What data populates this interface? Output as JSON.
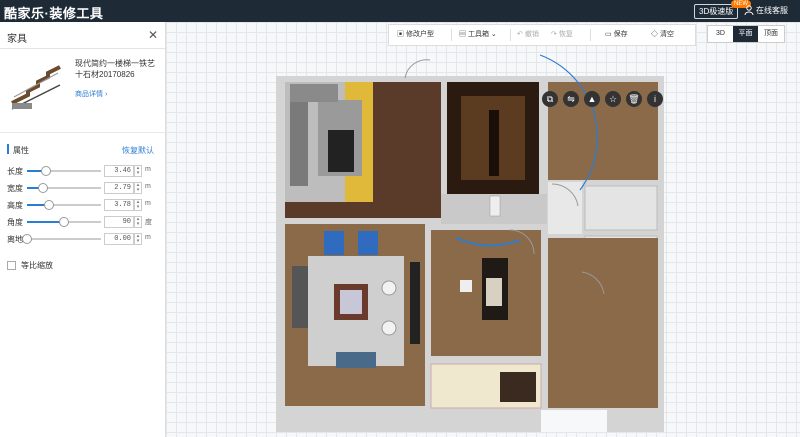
{
  "topbar": {
    "brand": "酷家乐·装修工具",
    "speed_button": "3D极速版",
    "speed_badge": "NEW",
    "service": "在线客服"
  },
  "panel": {
    "title": "家具",
    "product_name": "现代简约一楼梯一铁艺十石材20170826",
    "product_link": "商品详情 ›",
    "section_title": "属性",
    "reset_label": "恢复默认",
    "props": [
      {
        "label": "长度",
        "value": "3.46",
        "unit": "m",
        "level": 0.26
      },
      {
        "label": "宽度",
        "value": "2.79",
        "unit": "m",
        "level": 0.22
      },
      {
        "label": "高度",
        "value": "3.78",
        "unit": "m",
        "level": 0.3
      },
      {
        "label": "角度",
        "value": "90",
        "unit": "度",
        "level": 0.5
      },
      {
        "label": "离地",
        "value": "0.00",
        "unit": "m",
        "level": 0.0
      }
    ],
    "proportional_label": "等比缩放",
    "collapse_glyph": "‹‹"
  },
  "toolbar": {
    "modify_layout": "修改户型",
    "toolbox": "工具箱",
    "undo": "撤销",
    "redo": "恢复",
    "save": "保存",
    "clear": "清空"
  },
  "view_switch": {
    "v3d": "3D",
    "plan": "平面",
    "top": "顶面"
  },
  "colors": {
    "topbar": "#1e2a36",
    "accent": "#2b7cd3",
    "badge": "#ff7a00"
  },
  "icons": [
    "user-icon",
    "close-icon",
    "modify-layout-icon",
    "toolbox-icon",
    "undo-icon",
    "redo-icon",
    "save-icon",
    "clear-icon",
    "copy-icon",
    "flip-horizontal-icon",
    "flip-vertical-icon",
    "favorite-icon",
    "delete-icon",
    "info-icon"
  ]
}
